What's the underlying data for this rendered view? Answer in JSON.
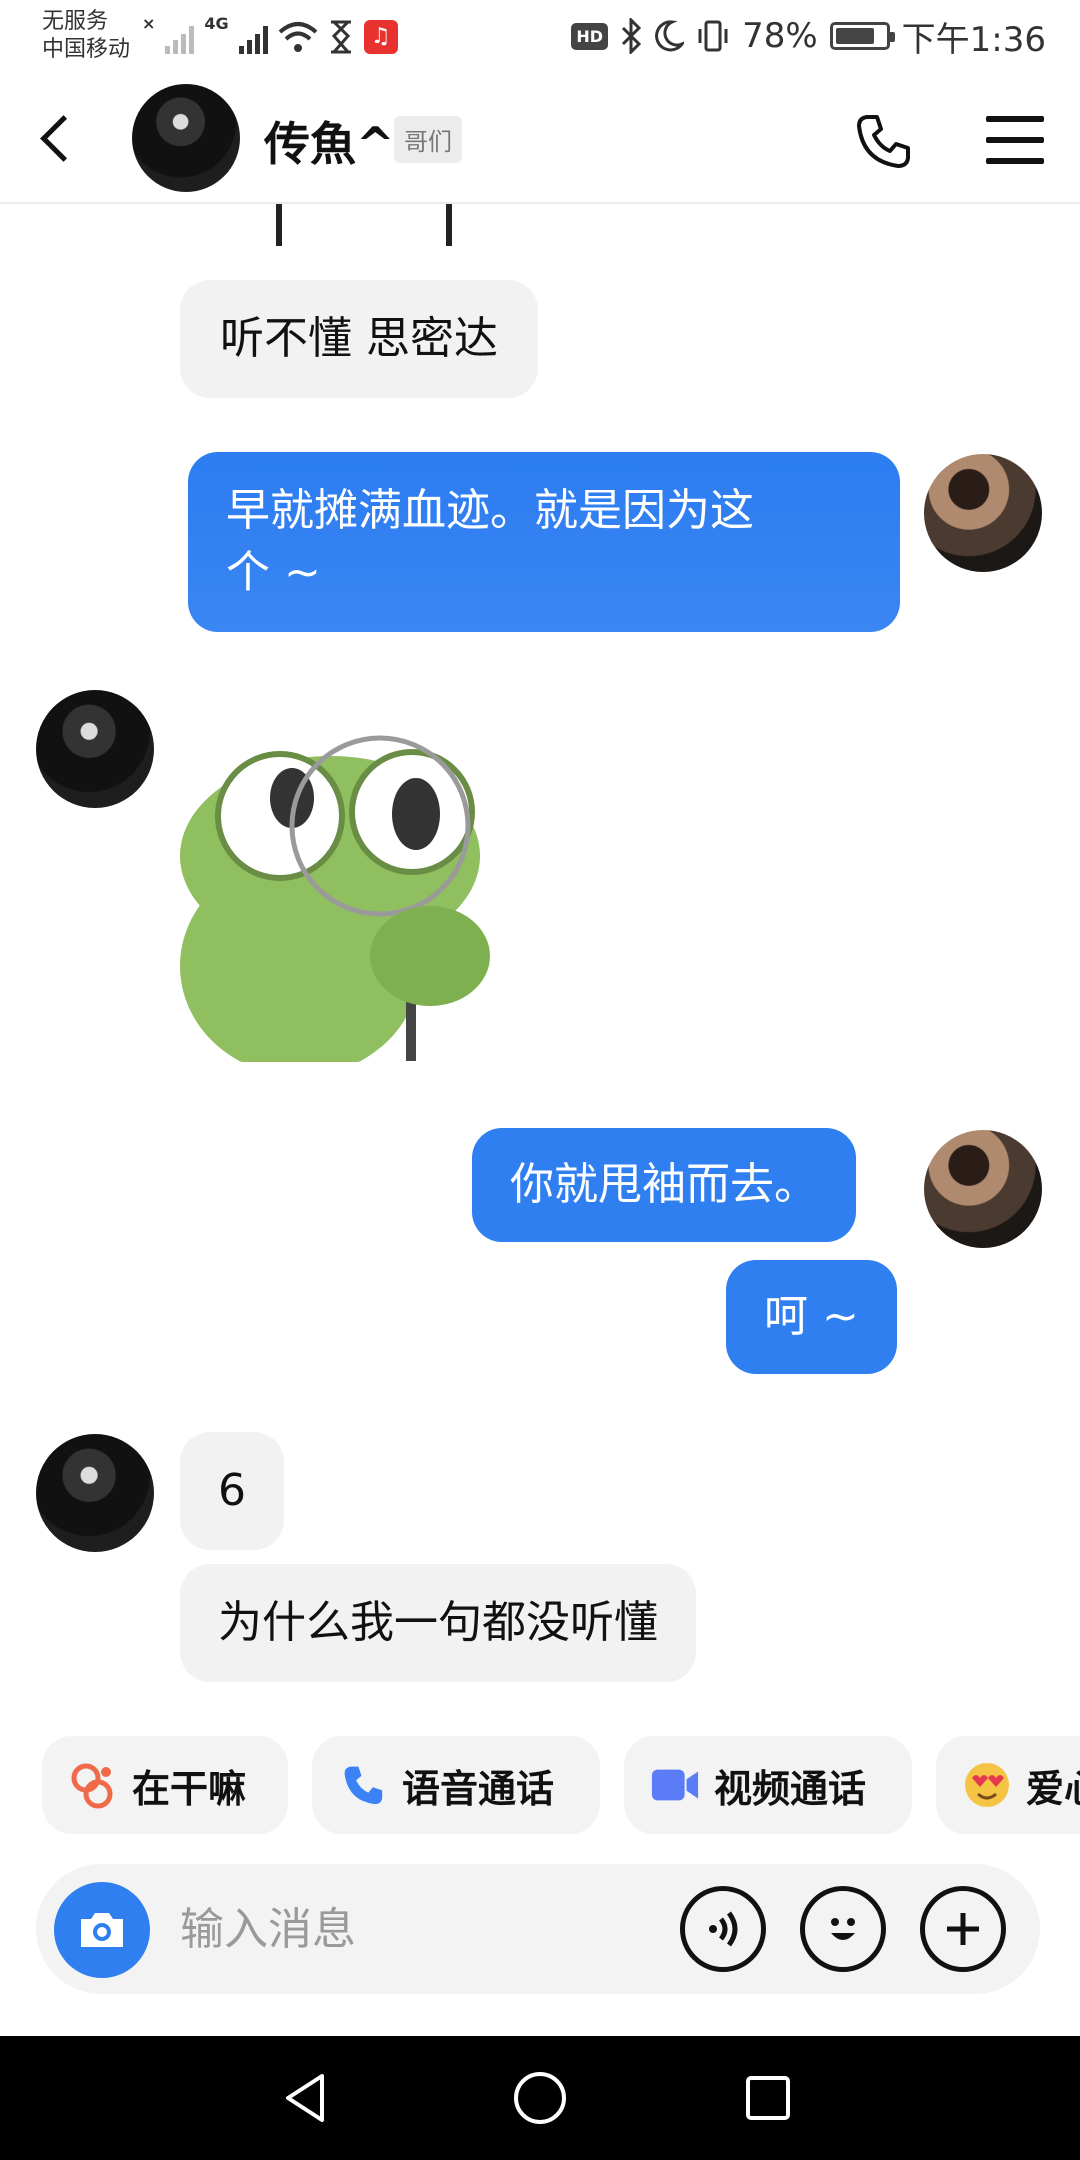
{
  "status_bar": {
    "carrier_line1": "无服务",
    "carrier_line2": "中国移动",
    "network": "4G",
    "battery_percent": "78%",
    "time": "下午1:36",
    "hd": "HD"
  },
  "header": {
    "contact_name": "传魚^",
    "relation_tag": "哥们"
  },
  "messages": [
    {
      "from": "contact",
      "type": "text",
      "text": "听不懂 思密达"
    },
    {
      "from": "self",
      "type": "text",
      "text_line1": "早就摊满血迹。就是因为这",
      "text_line2": "个 ~"
    },
    {
      "from": "contact",
      "type": "sticker",
      "sticker": "green-frog-with-magnifier"
    },
    {
      "from": "self",
      "type": "text",
      "text": "你就甩袖而去。"
    },
    {
      "from": "self",
      "type": "text",
      "text": "呵 ~"
    },
    {
      "from": "contact",
      "type": "text",
      "text": "6"
    },
    {
      "from": "contact",
      "type": "text",
      "text": "为什么我一句都没听懂"
    }
  ],
  "quick_actions": [
    {
      "label": "在干嘛",
      "icon": "poke-icon"
    },
    {
      "label": "语音通话",
      "icon": "phone-icon"
    },
    {
      "label": "视频通话",
      "icon": "video-icon"
    },
    {
      "label": "爱心",
      "icon": "heart-eyes-emoji"
    }
  ],
  "input": {
    "placeholder": "输入消息"
  },
  "colors": {
    "accent": "#2f7ff0",
    "incoming_bubble": "#f2f2f2",
    "outgoing_text": "#ffffff"
  }
}
